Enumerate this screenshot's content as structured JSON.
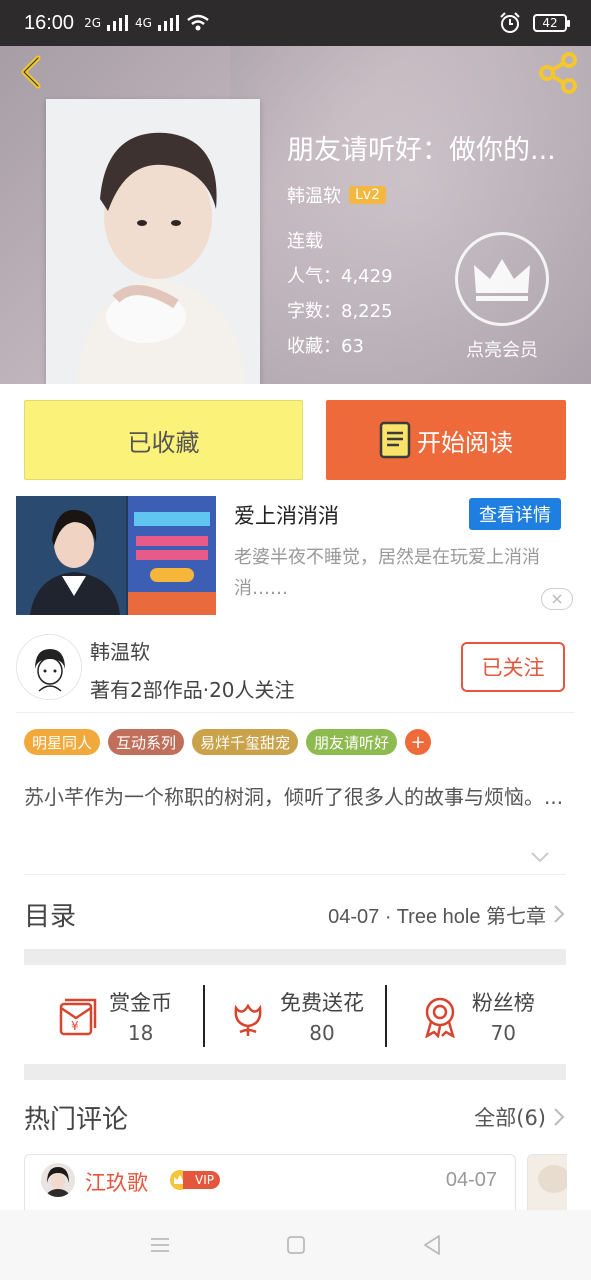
{
  "status_bar": {
    "time": "16:00",
    "net1": "2G",
    "net2": "4G",
    "battery": "42"
  },
  "book": {
    "title": "朋友请听好：做你的...",
    "author": "韩温软",
    "level": "Lv2",
    "status": "连载",
    "popularity_label": "人气：",
    "popularity": "4,429",
    "words_label": "字数：",
    "words": "8,225",
    "favorites_label": "收藏：",
    "favorites": "63",
    "vip_label": "点亮会员"
  },
  "actions": {
    "collected": "已收藏",
    "start_read": "开始阅读"
  },
  "ad": {
    "title": "爱上消消消",
    "detail_button": "查看详情",
    "description": "老婆半夜不睡觉，居然是在玩爱上消消消……"
  },
  "author_card": {
    "name": "韩温软",
    "meta": "著有2部作品·20人关注",
    "follow_label": "已关注"
  },
  "tags": [
    {
      "label": "明星同人",
      "color": "#f2a93b"
    },
    {
      "label": "互动系列",
      "color": "#c0705a"
    },
    {
      "label": "易烊千玺甜宠",
      "color": "#c9a24a"
    },
    {
      "label": "朋友请听好",
      "color": "#8dbb50"
    }
  ],
  "tag_more": "+",
  "description": "苏小芊作为一个称职的树洞，倾听了很多人的故事与烦恼。...",
  "toc": {
    "label": "目录",
    "latest": "04-07 · Tree hole 第七章"
  },
  "rewards": [
    {
      "label": "赏金币",
      "value": "18",
      "icon": "red-envelope-icon"
    },
    {
      "label": "免费送花",
      "value": "80",
      "icon": "flower-icon"
    },
    {
      "label": "粉丝榜",
      "value": "70",
      "icon": "medal-icon"
    }
  ],
  "hot_comments": {
    "label": "热门评论",
    "all_label": "全部(6)"
  },
  "comment": {
    "name": "江玖歌",
    "vip": "VIP",
    "date": "04-07"
  },
  "colors": {
    "accent": "#ee6a3b",
    "collected_bg": "#fbf27a",
    "follow": "#e4573d",
    "link_blue": "#1f7fe0"
  }
}
